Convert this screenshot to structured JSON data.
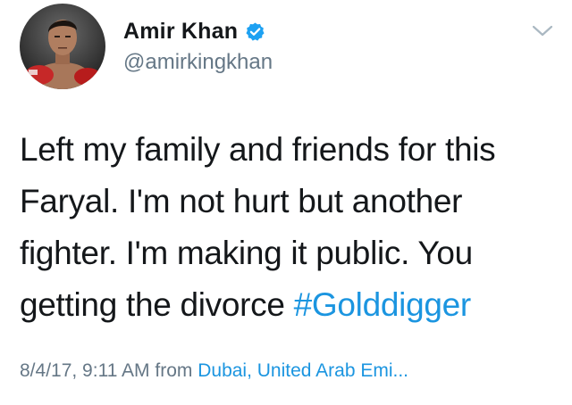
{
  "user": {
    "display_name": "Amir Khan",
    "handle": "@amirkingkhan",
    "verified": true,
    "avatar_icon": "boxer-avatar"
  },
  "tweet": {
    "lines": [
      "Left my family and friends for this",
      "Faryal. I'm not hurt but another",
      "fighter. I'm making it public. You",
      "getting the divorce "
    ],
    "hashtag": "#Golddigger"
  },
  "meta": {
    "timestamp": "8/4/17, 9:11 AM",
    "from_label": " from ",
    "location": "Dubai, United Arab Emi..."
  },
  "icons": {
    "verified_badge": "verified-badge-icon",
    "menu_caret": "chevron-down-icon"
  },
  "colors": {
    "link": "#1b95e0",
    "secondary": "#657786",
    "primary_text": "#14171a",
    "verified": "#1da1f2"
  }
}
